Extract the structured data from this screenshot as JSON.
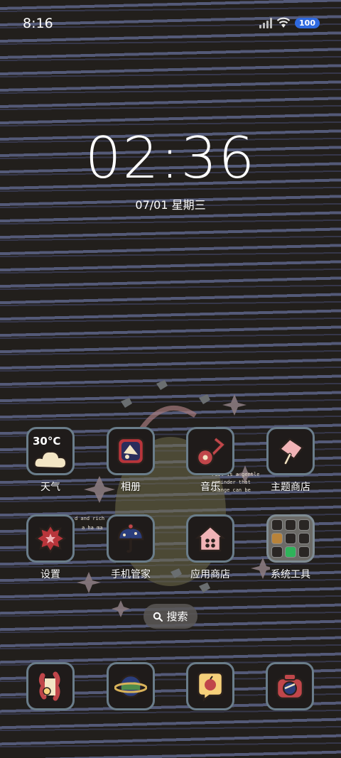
{
  "status": {
    "time": "8:16",
    "battery": "100"
  },
  "lock": {
    "clock": "02:36",
    "date": "07/01 星期三"
  },
  "weather": {
    "temp": "30°C"
  },
  "apps_row1": [
    {
      "label": "天气"
    },
    {
      "label": "相册"
    },
    {
      "label": "音乐"
    },
    {
      "label": "主题商店"
    }
  ],
  "apps_row2": [
    {
      "label": "设置"
    },
    {
      "label": "手机管家"
    },
    {
      "label": "应用商店"
    },
    {
      "label": "系统工具"
    }
  ],
  "search": {
    "label": "搜索"
  },
  "art": {
    "note_1": "Fail is a gentle",
    "note_2": "reminder that",
    "note_3": "change can be",
    "note_4": "d and rich",
    "note_5": "a ha ma"
  }
}
